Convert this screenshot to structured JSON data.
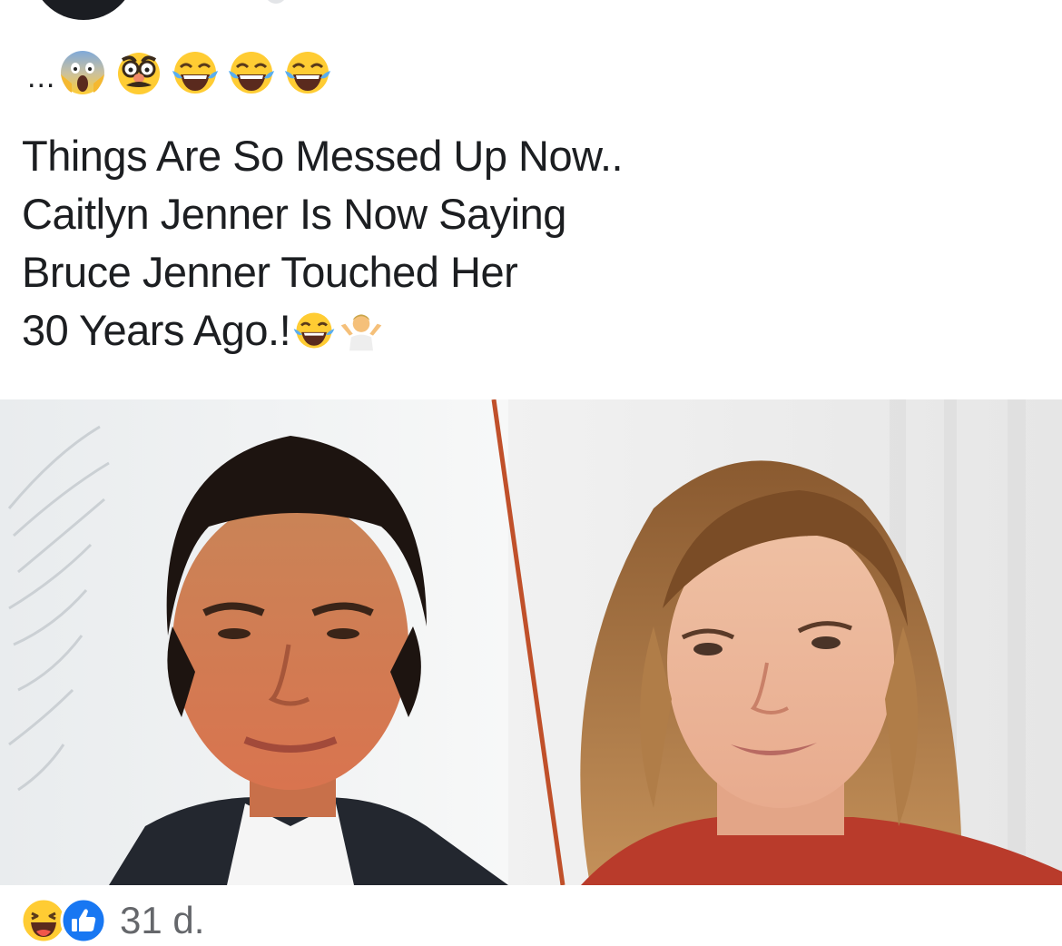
{
  "post": {
    "ellipsis": "...",
    "lead_emojis": [
      "face-screaming-in-fear",
      "disguised-face",
      "face-with-tears-of-joy",
      "face-with-tears-of-joy",
      "face-with-tears-of-joy"
    ],
    "headline_lines": [
      "Things Are So Messed Up Now..",
      "Caitlyn Jenner Is Now Saying",
      "Bruce Jenner Touched Her",
      "30 Years Ago.!"
    ],
    "headline_trailing_emojis": [
      "face-with-tears-of-joy",
      "person-shrugging"
    ]
  },
  "footer": {
    "reactions": [
      "haha-reaction",
      "like-reaction"
    ],
    "age": "31 d."
  },
  "colors": {
    "text": "#1c1e21",
    "muted": "#65676b",
    "like_blue": "#1877f2",
    "emoji_yellow": "#ffcc33"
  }
}
